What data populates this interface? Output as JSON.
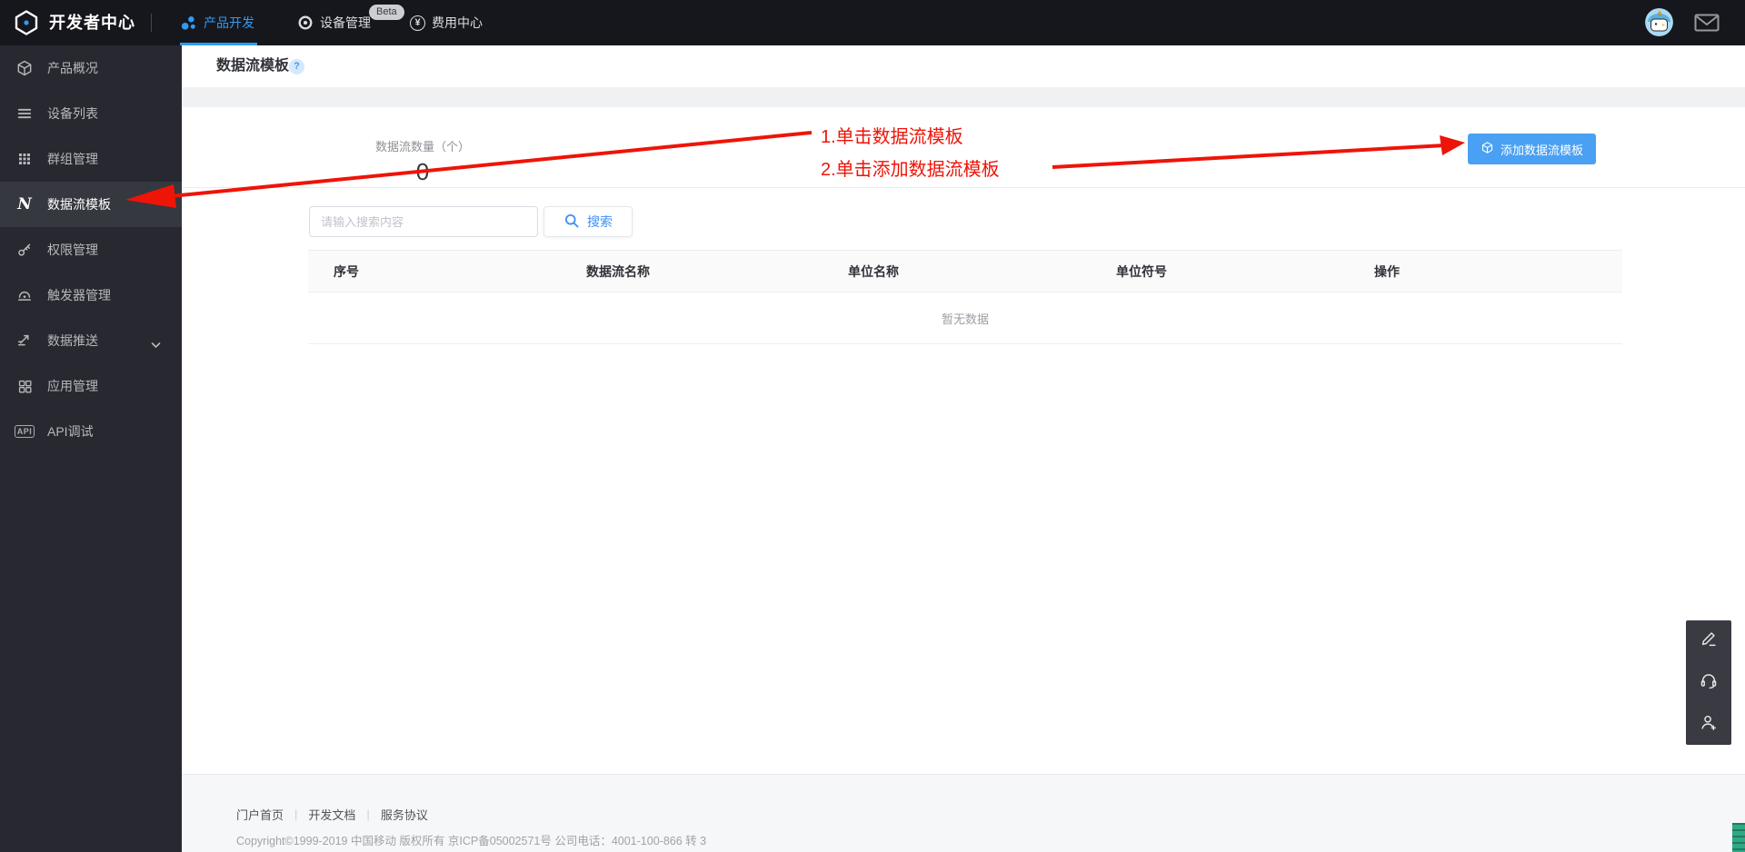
{
  "navbar": {
    "brand": "开发者中心",
    "tabs": [
      {
        "label": "产品开发",
        "icon": "product-dev-icon",
        "active": true
      },
      {
        "label": "设备管理",
        "icon": "device-mgmt-icon",
        "badge": "Beta"
      },
      {
        "label": "费用中心",
        "icon": "fee-icon",
        "icon_label": "¥"
      }
    ],
    "right_icons": [
      "penguin-avatar",
      "mail-icon"
    ]
  },
  "sidebar": {
    "items": [
      {
        "label": "产品概况",
        "icon": "cube-icon"
      },
      {
        "label": "设备列表",
        "icon": "list-icon"
      },
      {
        "label": "群组管理",
        "icon": "grid-dots-icon"
      },
      {
        "label": "数据流模板",
        "icon": "n-icon",
        "icon_label": "N",
        "active": true
      },
      {
        "label": "权限管理",
        "icon": "key-icon"
      },
      {
        "label": "触发器管理",
        "icon": "trigger-icon"
      },
      {
        "label": "数据推送",
        "icon": "push-icon",
        "expandable": true
      },
      {
        "label": "应用管理",
        "icon": "app-grid-icon"
      },
      {
        "label": "API调试",
        "icon": "api-icon",
        "icon_label": "API"
      }
    ]
  },
  "page": {
    "title": "数据流模板",
    "help": "?"
  },
  "stats": {
    "label": "数据流数量（个）",
    "value": "0"
  },
  "actions": {
    "add_button": "添加数据流模板"
  },
  "search": {
    "placeholder": "请输入搜索内容",
    "button": "搜索"
  },
  "table": {
    "columns": [
      "序号",
      "数据流名称",
      "单位名称",
      "单位符号",
      "操作"
    ],
    "empty_text": "暂无数据"
  },
  "annotations": {
    "step1": "1.单击数据流模板",
    "step2": "2.单击添加数据流模板",
    "color": "#ee1408"
  },
  "footer": {
    "links": [
      "门户首页",
      "开发文档",
      "服务协议"
    ],
    "copyright": "Copyright©1999-2019 中国移动 版权所有 京ICP备05002571号 公司电话：4001-100-866 转 3"
  },
  "colors": {
    "accent_blue": "#2f9bf4",
    "button_blue": "#4aa0f2",
    "annotation_red": "#ee1408",
    "navbar_bg": "#16171c",
    "sidebar_bg": "#282930",
    "sidebar_active_bg": "#36383f",
    "table_header_bg": "#fafafa",
    "footer_bg": "#f6f7f8"
  }
}
